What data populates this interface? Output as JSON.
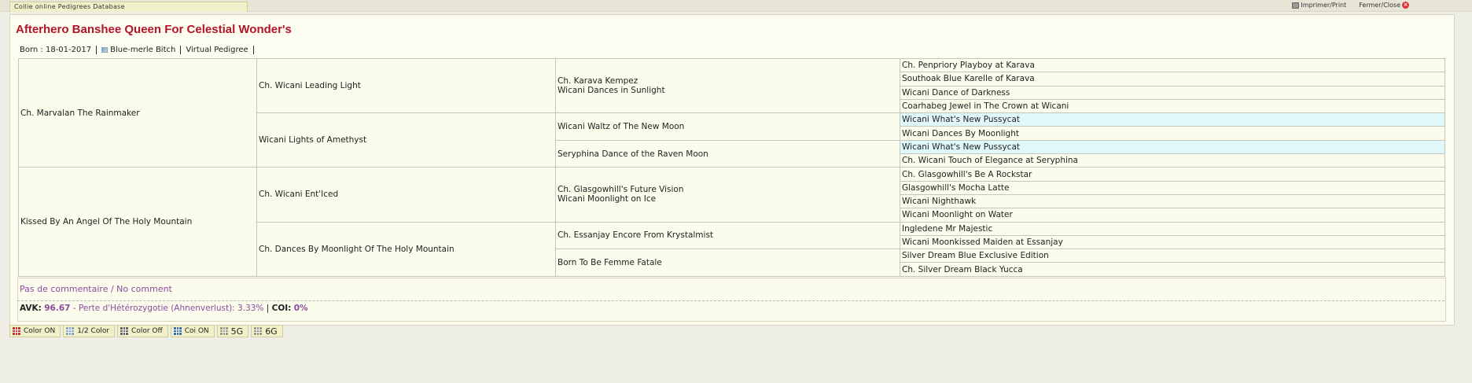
{
  "app": {
    "title": "Collie online Pedigrees Database"
  },
  "top_links": {
    "print": "Imprimer/Print",
    "close": "Fermer/Close"
  },
  "dog": {
    "name": "Afterhero Banshee Queen For Celestial Wonder's",
    "born": "Born : 18-01-2017",
    "color": "Blue-merle Bitch",
    "virtual": "Virtual Pedigree"
  },
  "pedigree": {
    "g1": [
      "Ch. Marvalan The Rainmaker",
      "Kissed By An Angel Of The Holy Mountain"
    ],
    "g2": [
      "Ch. Wicani Leading Light",
      "Wicani Lights of Amethyst",
      "Ch. Wicani Ent'Iced",
      "Ch. Dances By Moonlight Of The Holy Mountain"
    ],
    "g3": [
      "Ch. Karava Kempez",
      "Wicani Dances in Sunlight",
      "Wicani Waltz of The New Moon",
      "Seryphina Dance of the Raven Moon",
      "Ch. Glasgowhill's Future Vision",
      "Wicani Moonlight on Ice",
      "Ch. Essanjay Encore From Krystalmist",
      "Born To Be Femme Fatale"
    ],
    "g4": [
      "Ch. Penpriory Playboy at Karava",
      "Southoak Blue Karelle of Karava",
      "Wicani Dance of Darkness",
      "Coarhabeg Jewel in The Crown at Wicani",
      "Wicani What's New Pussycat",
      "Wicani Dances By Moonlight",
      "Wicani What's New Pussycat",
      "Ch. Wicani Touch of Elegance at Seryphina",
      "Ch. Glasgowhill's Be A Rockstar",
      "Glasgowhill's Mocha Latte",
      "Wicani Nighthawk",
      "Wicani Moonlight on Water",
      "Ingledene Mr Majestic",
      "Wicani Moonkissed Maiden at Essanjay",
      "Silver Dream Blue Exclusive Edition",
      "Ch. Silver Dream Black Yucca"
    ],
    "highlight_color": "#e0f8fa"
  },
  "comment": "Pas de commentaire / No comment",
  "stats": {
    "avk_label": "AVK:",
    "avk_value": "96.67",
    "loss_label": "- Perte d'Hétérozygotie (Ahnenverlust):",
    "loss_value": "3.33%",
    "coi_label": "COI:",
    "coi_value": "0%"
  },
  "toolbar": {
    "color_on": "Color ON",
    "half_color": "1/2 Color",
    "color_off": "Color Off",
    "coi_on": "Coi ON",
    "gen5": "5G",
    "gen6": "6G"
  }
}
